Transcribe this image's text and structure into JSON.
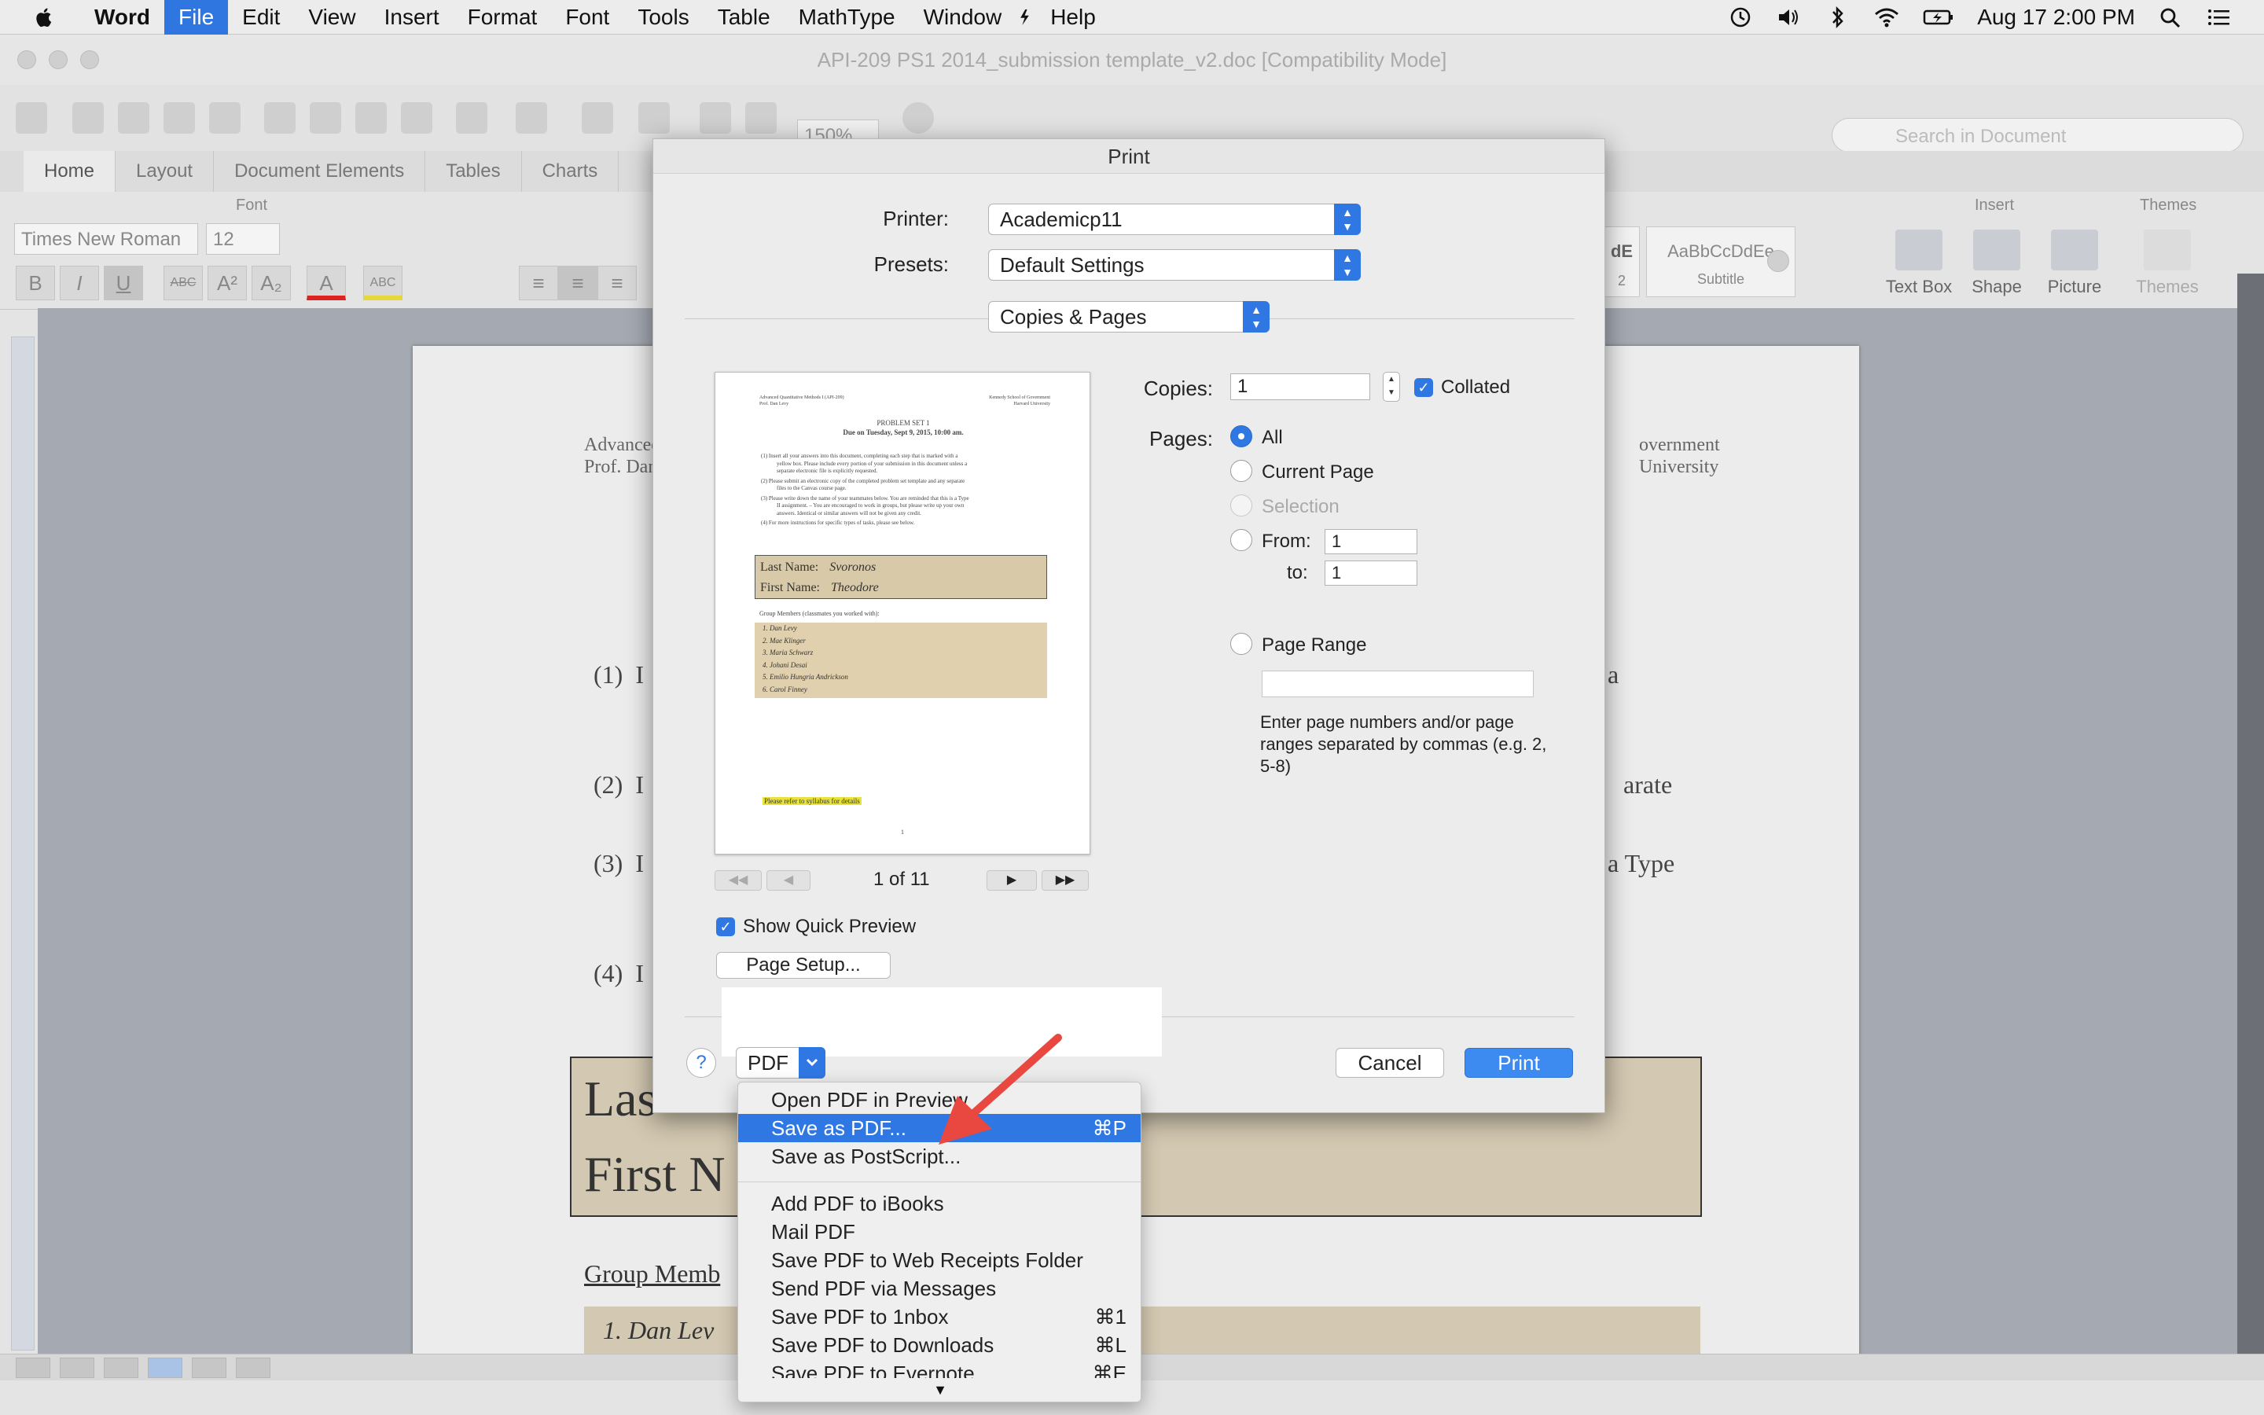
{
  "menubar": {
    "app": "Word",
    "items": [
      "File",
      "Edit",
      "View",
      "Insert",
      "Format",
      "Font",
      "Tools",
      "Table",
      "MathType",
      "Window",
      "Help"
    ],
    "active": "File",
    "clock": "Aug 17  2:00 PM"
  },
  "window": {
    "title": "API-209 PS1 2014_submission template_v2.doc [Compatibility Mode]",
    "zoom": "150%",
    "search_placeholder": "Search in Document"
  },
  "ribbon": {
    "tabs": [
      "Home",
      "Layout",
      "Document Elements",
      "Tables",
      "Charts"
    ],
    "font_group_label": "Font",
    "font_name": "Times New Roman",
    "font_size": "12",
    "insert_group_label": "Insert",
    "themes_group_label": "Themes",
    "style_1": "dE",
    "style_1_label": "2",
    "style_2": "AaBbCcDdEe",
    "style_2_label": "Subtitle",
    "insert_items": [
      "Text Box",
      "Shape",
      "Picture"
    ],
    "themes_label": "Themes"
  },
  "document": {
    "header_left_1": "Advanced",
    "header_left_2": "Prof. Dan",
    "header_right_1": "overnment",
    "header_right_2": "University",
    "list_items": [
      {
        "num": "(1)",
        "lead": "I",
        "tail": "a"
      },
      {
        "num": "(2)",
        "lead": "I",
        "tail": "arate"
      },
      {
        "num": "(3)",
        "lead": "I",
        "tail": "a Type"
      },
      {
        "num": "(4)",
        "lead": "I",
        "tail": ""
      }
    ],
    "last_name_partial": "Las",
    "first_name_partial": "First N",
    "group_members_partial": "Group Memb",
    "member_1_partial": "1.    Dan Lev"
  },
  "print": {
    "title": "Print",
    "printer_label": "Printer:",
    "printer": "Academicp11",
    "presets_label": "Presets:",
    "presets": "Default Settings",
    "section": "Copies & Pages",
    "copies_label": "Copies:",
    "copies": "1",
    "collated": "Collated",
    "pages_label": "Pages:",
    "opt_all": "All",
    "opt_current": "Current Page",
    "opt_selection": "Selection",
    "opt_from": "From:",
    "from_value": "1",
    "to_label": "to:",
    "to_value": "1",
    "opt_range": "Page Range",
    "range_help": "Enter page numbers and/or page ranges separated by commas (e.g. 2, 5-8)",
    "page_count": "1 of 11",
    "show_quick_preview": "Show Quick Preview",
    "page_setup": "Page Setup...",
    "pdf": "PDF",
    "cancel": "Cancel",
    "print_button": "Print",
    "help": "?"
  },
  "preview": {
    "hdr_left_1": "Advanced Quantitative Methods I (API-209)",
    "hdr_left_2": "Prof. Dan Levy",
    "hdr_right_1": "Kennedy School of Government",
    "hdr_right_2": "Harvard University",
    "title_1": "PROBLEM SET 1",
    "title_2": "Due on Tuesday, Sept 9, 2015, 10:00 am.",
    "instr_1a": "(1)    Insert all your answers into this document, completing each step that is marked with a",
    "instr_1b": "yellow box. Please include every portion of your submission in this document unless a",
    "instr_1c": "separate electronic file is explicitly requested.",
    "instr_2a": "(2)    Please submit an electronic copy of the completed problem set template and any separate",
    "instr_2b": "files to the Canvas course page.",
    "instr_3a": "(3)    Please write down the name of your teammates below. You are reminded that this is a Type",
    "instr_3b": "II assignment. – You are encouraged to work in groups, but please write up your own",
    "instr_3c": "answers. Identical or similar answers will not be given any credit.",
    "instr_4": "(4)    For more instructions for specific types of tasks, please see below.",
    "last_name_label": "Last Name:",
    "last_name": "Svoronos",
    "first_name_label": "First Name:",
    "first_name": "Theodore",
    "group_label": "Group Members (classmates you worked with):",
    "members": [
      "1.    Dan Levy",
      "2.    Mae Klinger",
      "3.    Maria Schwarz",
      "4.    Johani Desai",
      "5.    Emilio Hungria Andrickson",
      "6.    Carol Finney"
    ],
    "footer_note": "Please refer to syllabus for details",
    "page_num": "1"
  },
  "pdf_menu": {
    "items": [
      {
        "label": "Open PDF in Preview",
        "shortcut": ""
      },
      {
        "label": "Save as PDF...",
        "shortcut": "⌘P"
      },
      {
        "label": "Save as PostScript...",
        "shortcut": ""
      },
      {
        "label": "Add PDF to iBooks",
        "shortcut": ""
      },
      {
        "label": "Mail PDF",
        "shortcut": ""
      },
      {
        "label": "Save PDF to Web Receipts Folder",
        "shortcut": ""
      },
      {
        "label": "Send PDF via Messages",
        "shortcut": ""
      },
      {
        "label": "Save PDF to 1nbox",
        "shortcut": "⌘1"
      },
      {
        "label": "Save PDF to Downloads",
        "shortcut": "⌘L"
      },
      {
        "label": "Save PDF to Evernote",
        "shortcut": "⌘E"
      }
    ],
    "selected": "Save as PDF..."
  },
  "colors": {
    "accent": "#2f78e4",
    "annotation_arrow": "#e8483f",
    "highlight_fill": "#d3c8b1"
  }
}
